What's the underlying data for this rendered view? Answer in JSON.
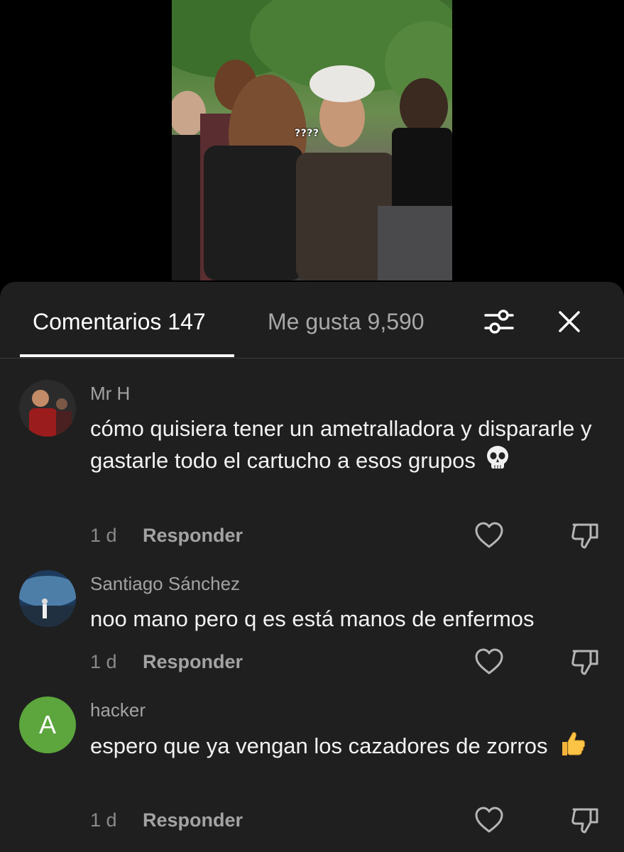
{
  "video": {
    "caption": "????"
  },
  "comments_sheet": {
    "tabs": {
      "comments_label": "Comentarios 147",
      "likes_label": "Me gusta 9,590"
    },
    "comments": [
      {
        "username": "Mr H",
        "text": "cómo quisiera tener un ametralladora y dispararle y gastarle todo el cartucho a esos grupos",
        "emoji": "skull-emoji",
        "time": "1 d",
        "reply_label": "Responder"
      },
      {
        "username": "Santiago Sánchez",
        "text": "noo mano pero q es está manos de enfermos",
        "time": "1 d",
        "reply_label": "Responder"
      },
      {
        "username": "hacker",
        "avatar_letter": "A",
        "text": "espero que ya vengan los cazadores de zorros",
        "emoji": "thumbs-up-emoji",
        "time": "1 d",
        "reply_label": "Responder"
      }
    ]
  },
  "colors": {
    "sheet_background": "#1f1f1f",
    "avatar_green": "#5ca63d",
    "muted_text": "#a3a3a3"
  }
}
